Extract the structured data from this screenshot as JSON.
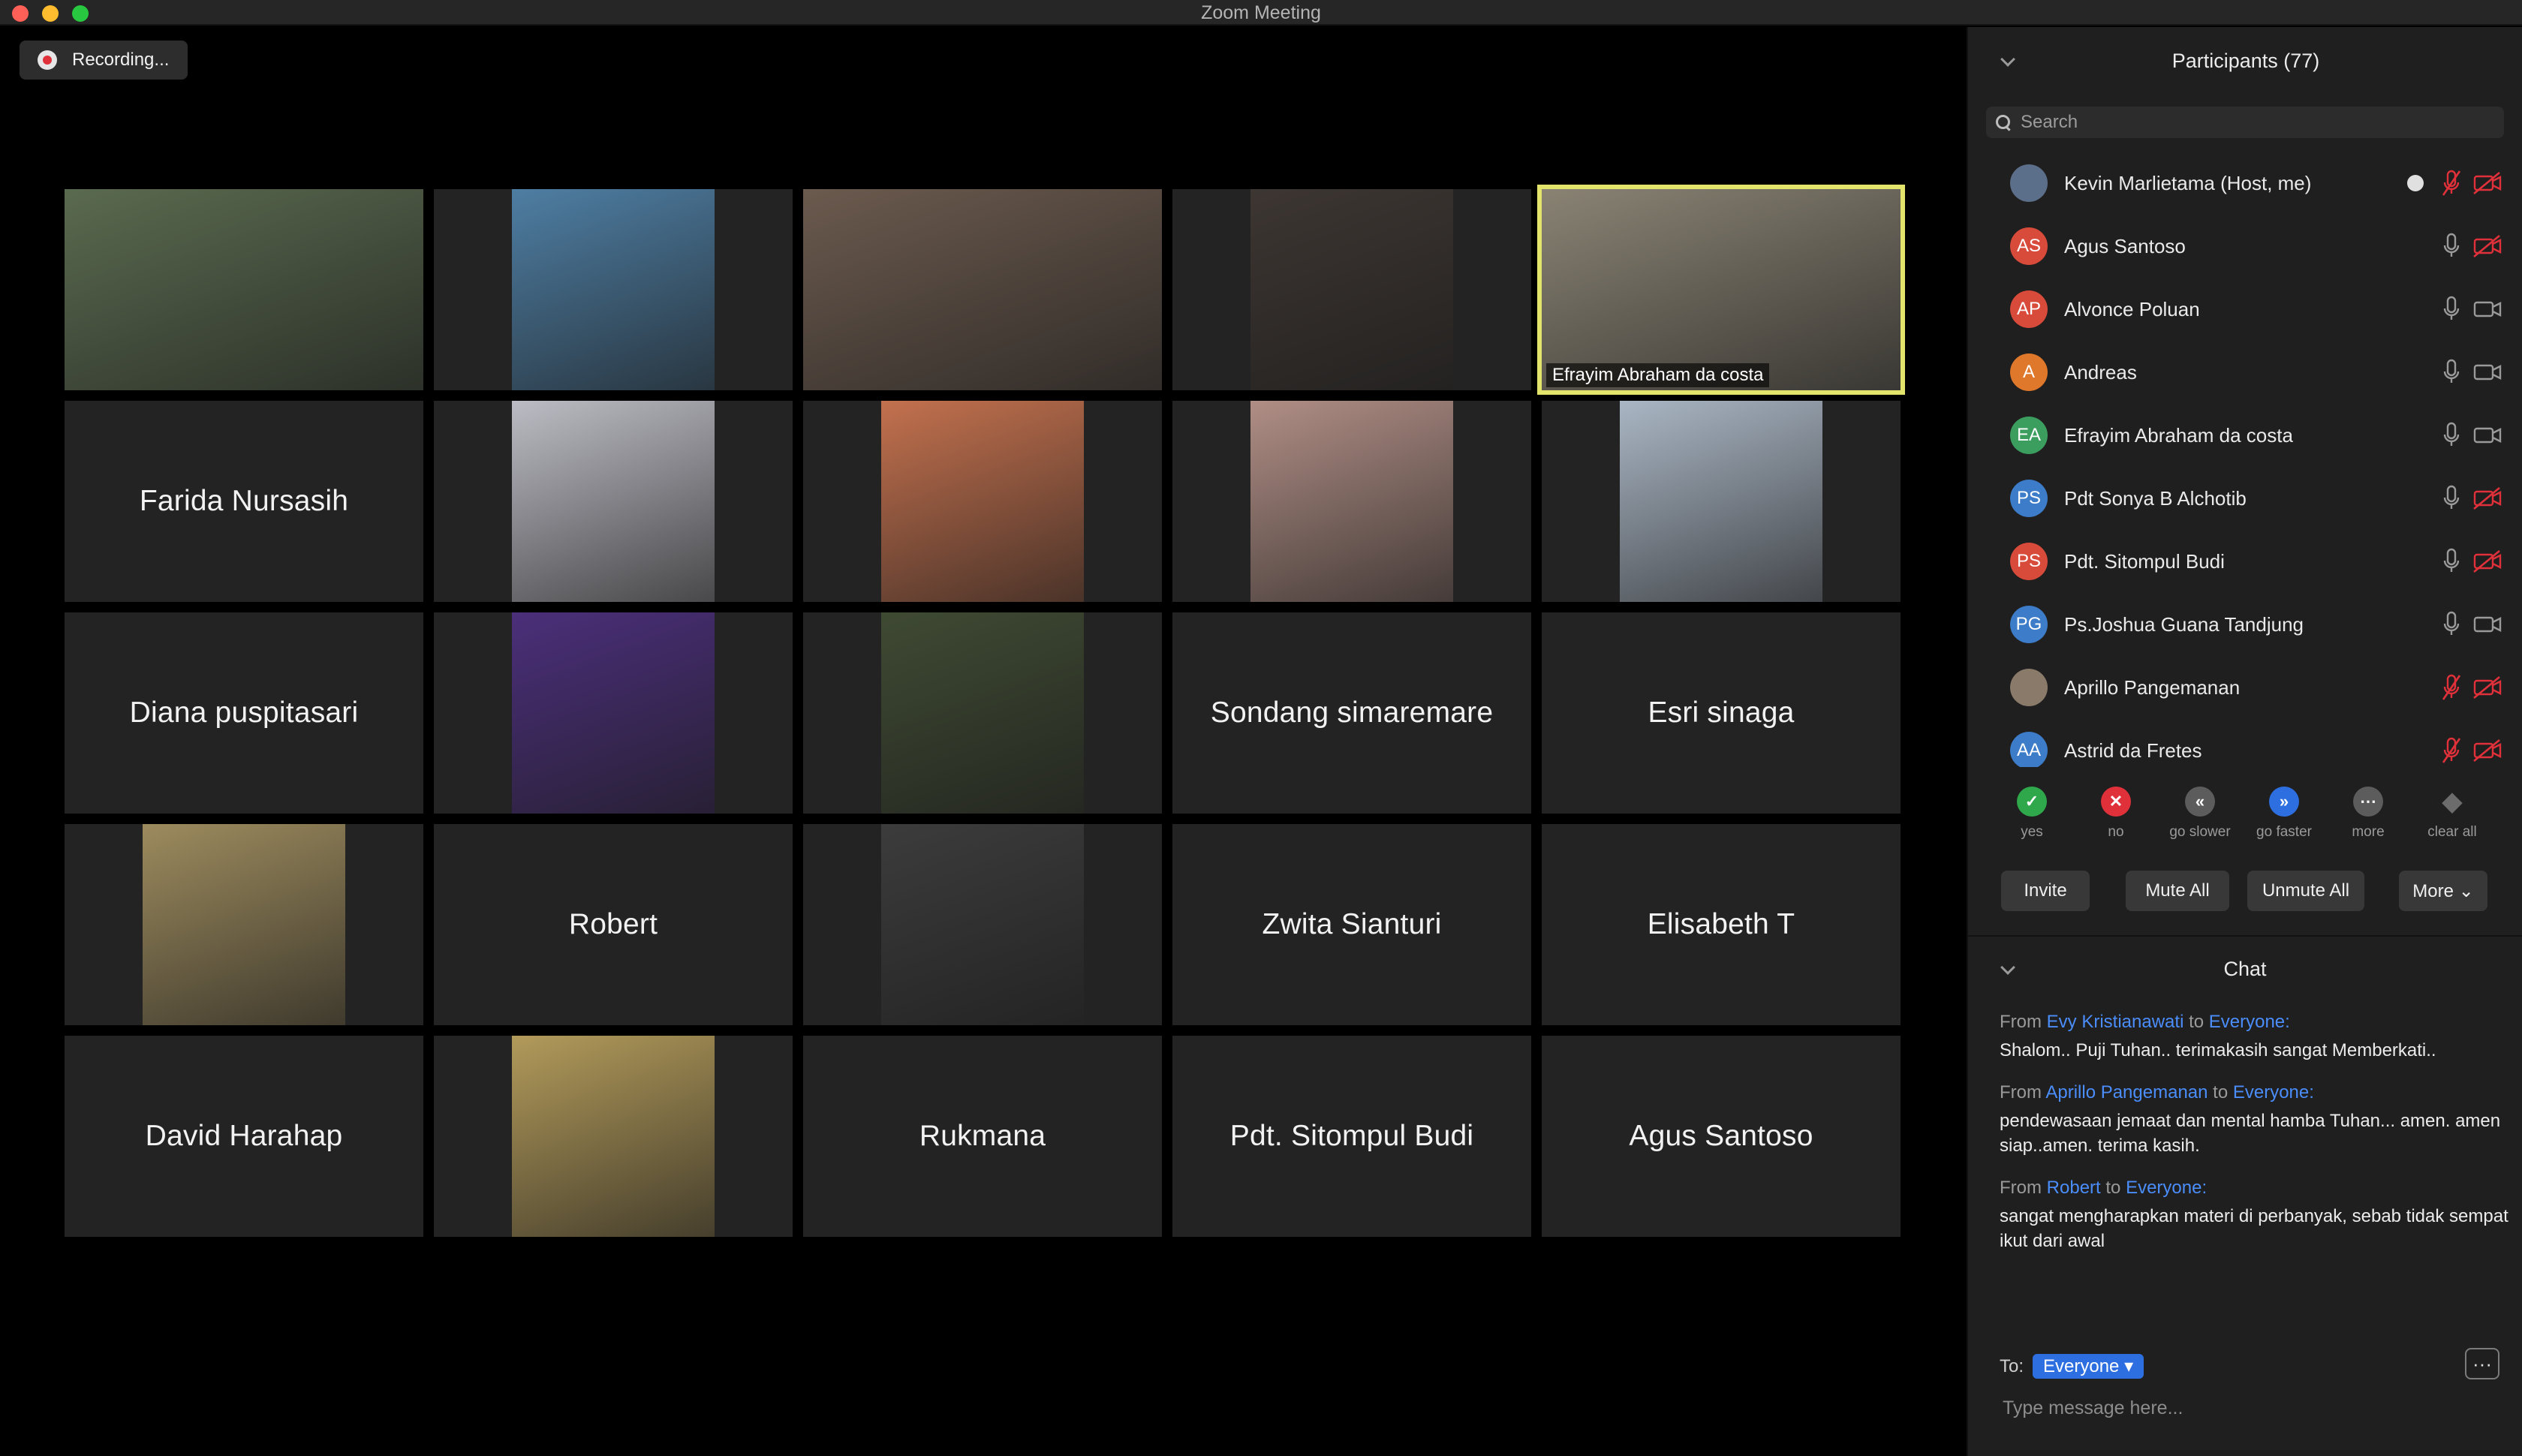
{
  "window": {
    "title": "Zoom Meeting"
  },
  "recording": {
    "label": "Recording..."
  },
  "gallery": {
    "tiles": [
      {
        "name": "",
        "photo": "#5a6a4f",
        "active": false
      },
      {
        "name": "",
        "photo": "#4e7ea3",
        "active": false
      },
      {
        "name": "",
        "photo": "#6b5a4e",
        "active": false
      },
      {
        "name": "",
        "photo": "#3d3632",
        "active": false
      },
      {
        "name": "",
        "photo": "#8a8374",
        "active": true,
        "caption": "Efrayim Abraham da costa"
      },
      {
        "name": "Farida Nursasih"
      },
      {
        "name": "",
        "photo": "#bcbcc4"
      },
      {
        "name": "",
        "photo": "#c3714e"
      },
      {
        "name": "",
        "photo": "#b08e85"
      },
      {
        "name": "",
        "photo": "#aab6c4"
      },
      {
        "name": "Diana puspitasari"
      },
      {
        "name": "",
        "photo": "#4b2f7a"
      },
      {
        "name": "",
        "photo": "#3f4a33"
      },
      {
        "name": "Sondang simaremare"
      },
      {
        "name": "Esri sinaga"
      },
      {
        "name": "",
        "photo": "#9d8b5e"
      },
      {
        "name": "Robert"
      },
      {
        "name": "",
        "photo": "#3c3c3c"
      },
      {
        "name": "Zwita Sianturi"
      },
      {
        "name": "Elisabeth T"
      },
      {
        "name": "David Harahap"
      },
      {
        "name": "",
        "photo": "#b29a5a"
      },
      {
        "name": "Rukmana"
      },
      {
        "name": "Pdt. Sitompul Budi"
      },
      {
        "name": "Agus Santoso"
      }
    ]
  },
  "participants": {
    "title": "Participants (77)",
    "search_placeholder": "Search",
    "items": [
      {
        "initials": "",
        "name": "Kevin Marlietama (Host, me)",
        "color": "#5c6f8a",
        "mic": "muted",
        "cam": "off",
        "host": true
      },
      {
        "initials": "AS",
        "name": "Agus Santoso",
        "color": "#d84a3a",
        "mic": "on",
        "cam": "off"
      },
      {
        "initials": "AP",
        "name": "Alvonce Poluan",
        "color": "#d84a3a",
        "mic": "on",
        "cam": "on"
      },
      {
        "initials": "A",
        "name": "Andreas",
        "color": "#e0782c",
        "mic": "on",
        "cam": "on"
      },
      {
        "initials": "EA",
        "name": "Efrayim Abraham da costa",
        "color": "#3b9e5f",
        "mic": "on",
        "cam": "on"
      },
      {
        "initials": "PS",
        "name": "Pdt Sonya B Alchotib",
        "color": "#3c7cc9",
        "mic": "on",
        "cam": "off"
      },
      {
        "initials": "PS",
        "name": "Pdt. Sitompul Budi",
        "color": "#d84a3a",
        "mic": "on",
        "cam": "off"
      },
      {
        "initials": "PG",
        "name": "Ps.Joshua Guana Tandjung",
        "color": "#3c7cc9",
        "mic": "on",
        "cam": "on"
      },
      {
        "initials": "",
        "name": "Aprillo Pangemanan",
        "color": "#8a7a6a",
        "mic": "muted",
        "cam": "off"
      },
      {
        "initials": "AA",
        "name": "Astrid da Fretes",
        "color": "#3c7cc9",
        "mic": "muted",
        "cam": "off"
      }
    ]
  },
  "reactions": [
    {
      "label": "yes",
      "glyph": "✓",
      "color": "#2ea84a"
    },
    {
      "label": "no",
      "glyph": "✕",
      "color": "#e0313b"
    },
    {
      "label": "go slower",
      "glyph": "«",
      "color": "#5c5c5c"
    },
    {
      "label": "go faster",
      "glyph": "»",
      "color": "#2d6fe0"
    },
    {
      "label": "more",
      "glyph": "⋯",
      "color": "#5c5c5c"
    },
    {
      "label": "clear all",
      "glyph": "◆",
      "color": "#1f1f1f"
    }
  ],
  "buttons": {
    "invite": "Invite",
    "mute_all": "Mute All",
    "unmute_all": "Unmute All",
    "more": "More ⌄"
  },
  "chat": {
    "title": "Chat",
    "messages": [
      {
        "from_prefix": "From",
        "from": "Evy Kristianawati",
        "to_word": "to",
        "to": "Everyone:",
        "body": "Shalom.. Puji Tuhan.. terimakasih sangat Memberkati.."
      },
      {
        "from_prefix": "From",
        "from": "Aprillo Pangemanan",
        "to_word": "to",
        "to": "Everyone:",
        "body": "pendewasaan jemaat dan mental hamba Tuhan... amen. amen\nsiap..amen. terima kasih."
      },
      {
        "from_prefix": "From",
        "from": "Robert",
        "to_word": "to",
        "to": "Everyone:",
        "body": "sangat mengharapkan materi di perbanyak, sebab tidak sempat ikut dari awal"
      }
    ],
    "to_label": "To:",
    "to_target": "Everyone ▾",
    "more_glyph": "···",
    "input_placeholder": "Type message here..."
  }
}
